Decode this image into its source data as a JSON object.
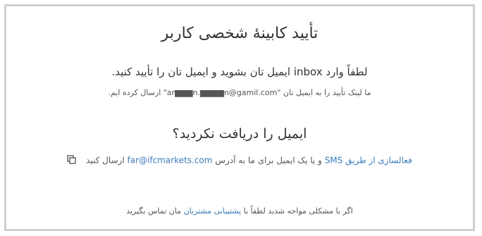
{
  "title": "تأیید کابینهٔ شخصی کاربر",
  "instruction": {
    "text": "لطفاً وارد inbox ایمیل تان بشوید و ایمیل تان را تأیید کنید."
  },
  "sent_notice": {
    "prefix": "ما لینک تأیید را به ایمیل تان",
    "email": "\"ar▆▆▆n.▆▆▆▆n@gamil.com\"",
    "suffix": "ارسال کرده ایم."
  },
  "not_received": {
    "heading": "ایمیل را دریافت نکردید؟"
  },
  "activation": {
    "link_sms": "فعالسازی از طریق SMS",
    "middle": "و یا یک ایمیل برای ما به آدرس",
    "email_link": "far@ifcmarkets.com",
    "suffix": "ارسال کنید"
  },
  "footer": {
    "prefix": "اگر با مشکلی مواجه شدید لطفاً با",
    "support_link": "پشتیبانی مشتریان",
    "suffix": "مان تماس بگیرید"
  },
  "colors": {
    "link": "#3a7ab8",
    "border": "#cfcfcf",
    "text": "#333333"
  }
}
